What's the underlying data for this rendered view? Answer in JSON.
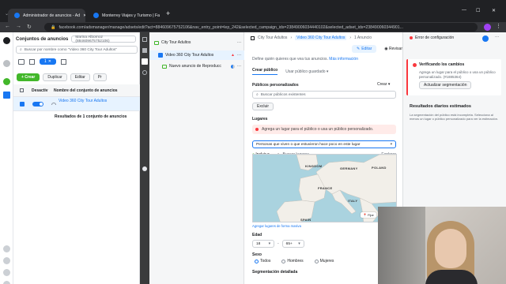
{
  "browser": {
    "tabs": [
      {
        "title": "Administrador de anuncios - Ad",
        "active": true
      },
      {
        "title": "Monterrey Viajes y Turismo | Fa",
        "active": false
      }
    ],
    "new_tab": "+",
    "url": "facebook.com/adsmanager/manage/adsets/edit?act=884609675752106&nav_entry_point=lep_242&selected_campaign_ids=23849006034440102&selected_adset_ids=238490060344901..."
  },
  "list_panel": {
    "title": "Conjuntos de anuncios",
    "account": "Marina Albornoz (884609675752106)",
    "search_placeholder": "Buscar por nombre como \"Video 360 City Tour Adultos\"",
    "count_badge": "1",
    "toolbar": {
      "create": "+ Crear",
      "duplicate": "Duplicar",
      "edit": "Editar",
      "more": "Pr"
    },
    "columns": {
      "status": "Desactiv",
      "name": "Nombre del conjunto de anuncios"
    },
    "rows": [
      {
        "name": "Video 360 City Tour Adultos"
      }
    ],
    "results": "Resultados de 1 conjunto de anuncios"
  },
  "tree": {
    "campaign": "City Tour Adultos",
    "adset": "Video 360 City Tour Adultos",
    "ad": "Nuevo anuncio de Reproducción..."
  },
  "editor": {
    "breadcrumb": [
      "City Tour Adultos",
      "Video 360 City Tour Adultos",
      "1 Anuncio"
    ],
    "error_label": "Error de configuración",
    "edit_tab": "Editar",
    "review_tab": "Revisar",
    "intro_text": "Define quién quieres que vea tus anuncios.",
    "intro_link": "Más información",
    "audience_tabs": [
      "Crear público",
      "Usar público guardado"
    ],
    "custom_audiences_label": "Públicos personalizados",
    "create_dropdown": "Crear",
    "custom_search_placeholder": "Buscar públicos existentes",
    "exclude_button": "Excluir",
    "locations_label": "Lugares",
    "locations_error": "Agrega un lugar para el público o usa un público personalizado.",
    "locations_select": "Personas que viven o que estuvieron hace poco en este lugar",
    "include_label": "Incluir",
    "search_places_placeholder": "Buscar lugares",
    "explore_link": "Explorar",
    "map_pin_label": "Fijar",
    "bulk_locations_link": "Agregar lugares de forma masiva",
    "map_labels": [
      "KINGDOM",
      "GERMANY",
      "POLAND",
      "FRANCE",
      "ITALY",
      "SPAIN"
    ],
    "age_label": "Edad",
    "age_min": "18",
    "age_max": "65+",
    "gender_label": "Sexo",
    "genders": [
      "Todos",
      "Hombres",
      "Mujeres"
    ],
    "detailed_targeting_label": "Segmentación detallada"
  },
  "right_panel": {
    "checking_title": "Verificando los cambios",
    "checking_text": "Agrega un lugar para el público o usa un público personalizado. (#1885364)",
    "update_button": "Actualizar segmentación",
    "estimates_title": "Resultados diarios estimados",
    "estimates_text": "La segmentación del público está incompleta. Selecciona al menos un lugar o público personalizado para ver la estimación."
  },
  "colors": {
    "fb_blue": "#1877f2",
    "error_red": "#fa383e",
    "green": "#42b72a"
  }
}
